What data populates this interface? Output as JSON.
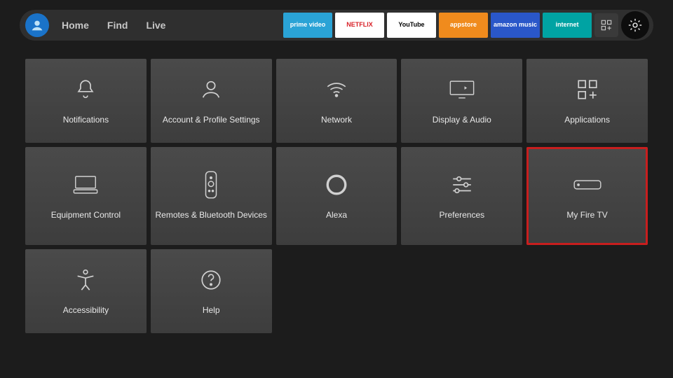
{
  "nav": {
    "items": [
      "Home",
      "Find",
      "Live"
    ]
  },
  "apps": [
    {
      "name": "prime video",
      "bg": "#2aa3d6",
      "fg": "#ffffff"
    },
    {
      "name": "NETFLIX",
      "bg": "#ffffff",
      "fg": "#d81f26"
    },
    {
      "name": "YouTube",
      "bg": "#ffffff",
      "fg": "#000000"
    },
    {
      "name": "appstore",
      "bg": "#f08b1d",
      "fg": "#ffffff"
    },
    {
      "name": "amazon music",
      "bg": "#2a57c9",
      "fg": "#ffffff"
    },
    {
      "name": "internet",
      "bg": "#00a3a3",
      "fg": "#ffffff"
    }
  ],
  "tiles": [
    {
      "label": "Notifications",
      "icon": "bell"
    },
    {
      "label": "Account & Profile Settings",
      "icon": "user"
    },
    {
      "label": "Network",
      "icon": "wifi"
    },
    {
      "label": "Display & Audio",
      "icon": "display"
    },
    {
      "label": "Applications",
      "icon": "apps"
    },
    {
      "label": "Equipment Control",
      "icon": "equipment"
    },
    {
      "label": "Remotes & Bluetooth Devices",
      "icon": "remote"
    },
    {
      "label": "Alexa",
      "icon": "alexa"
    },
    {
      "label": "Preferences",
      "icon": "sliders"
    },
    {
      "label": "My Fire TV",
      "icon": "firetv",
      "highlight": true
    },
    {
      "label": "Accessibility",
      "icon": "access"
    },
    {
      "label": "Help",
      "icon": "help"
    }
  ]
}
